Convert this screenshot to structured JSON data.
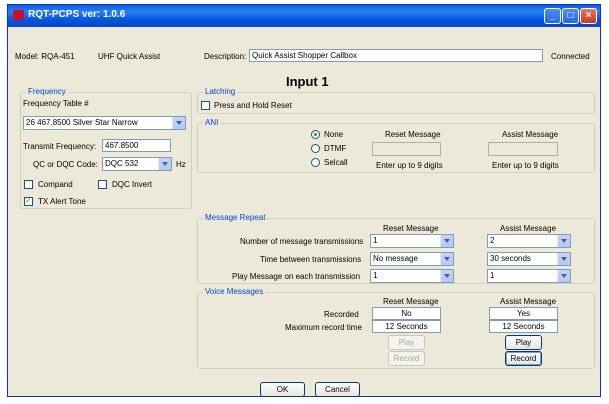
{
  "window": {
    "title": "RQT-PCPS ver: 1.0.6"
  },
  "header": {
    "model": "Model: RQA-451",
    "type": "UHF Quick Assist",
    "description_label": "Description:",
    "description_value": "Quick Assist Shopper Callbox",
    "status": "Connected"
  },
  "input_title": "Input 1",
  "frequency": {
    "legend": "Frequency",
    "table_label": "Frequency Table #",
    "table_value": "26  467.8500  Silver Star Narrow",
    "transmit_label": "Transmit Frequency:",
    "transmit_value": "467.8500",
    "code_label": "QC or DQC Code:",
    "code_value": "DQC 532",
    "hz_label": "Hz",
    "compand_label": "Compand",
    "dqc_invert_label": "DQC Invert",
    "tx_alert_label": "TX Alert Tone",
    "tx_alert_checked": true
  },
  "latching": {
    "legend": "Latching",
    "press_hold_label": "Press and Hold Reset"
  },
  "ani": {
    "legend": "ANI",
    "options": [
      "None",
      "DTMF",
      "Selcall"
    ],
    "selected": "None",
    "reset_header": "Reset Message",
    "assist_header": "Assist Message",
    "reset_hint": "Enter up to 9 digits",
    "assist_hint": "Enter up to 9 digits"
  },
  "repeat": {
    "legend": "Message Repeat",
    "reset_header": "Reset Message",
    "assist_header": "Assist Message",
    "rows": [
      {
        "label": "Number of message transmissions",
        "reset": "1",
        "assist": "2"
      },
      {
        "label": "Time between transmissions",
        "reset": "No message",
        "assist": "30 seconds"
      },
      {
        "label": "Play Message on each transmission",
        "reset": "1",
        "assist": "1"
      }
    ]
  },
  "voice": {
    "legend": "Voice Messages",
    "reset_header": "Reset Message",
    "assist_header": "Assist Message",
    "recorded_label": "Recorded",
    "recorded_reset": "No",
    "recorded_assist": "Yes",
    "max_label": "Maximum record time",
    "max_reset": "12 Seconds",
    "max_assist": "12 Seconds",
    "play_label": "Play",
    "record_label": "Record"
  },
  "footer": {
    "ok_label": "OK",
    "cancel_label": "Cancel"
  }
}
